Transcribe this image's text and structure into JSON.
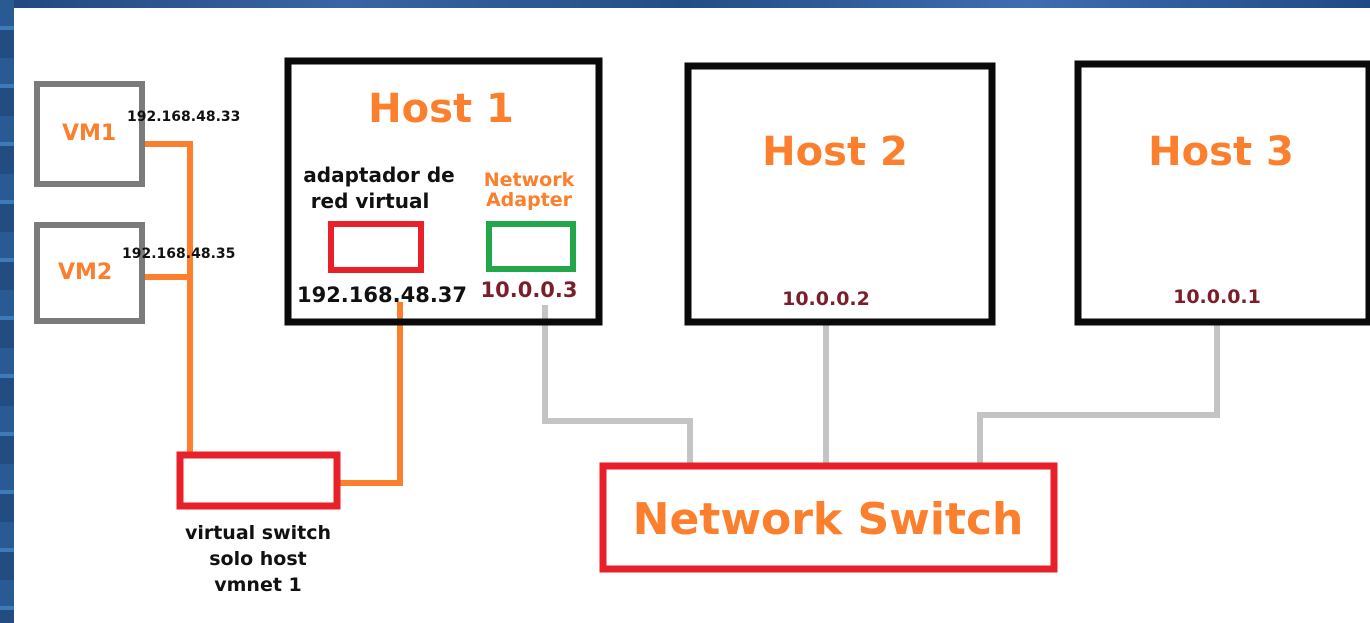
{
  "vms": [
    {
      "name": "VM1",
      "ip": "192.168.48.33"
    },
    {
      "name": "VM2",
      "ip": "192.168.48.35"
    }
  ],
  "hosts": [
    {
      "name": "Host 1",
      "virtual_adapter_label": [
        "adaptador de",
        "red virtual"
      ],
      "virtual_adapter_ip": "192.168.48.37",
      "network_adapter_label": [
        "Network",
        "Adapter"
      ],
      "network_adapter_ip": "10.0.0.3"
    },
    {
      "name": "Host 2",
      "ip": "10.0.0.2"
    },
    {
      "name": "Host 3",
      "ip": "10.0.0.1"
    }
  ],
  "virtual_switch": {
    "label": [
      "virtual switch",
      "solo host",
      "vmnet 1"
    ]
  },
  "network_switch": {
    "label": "Network Switch"
  },
  "colors": {
    "orange": "#fb7f2c",
    "red_box": "#e8202a",
    "green_box": "#22a84a",
    "ip_dark_red": "#7a1e2a",
    "gray_box": "#7b7b7b",
    "gray_link": "#c4c4c4",
    "black_box": "#0a0a0a"
  }
}
